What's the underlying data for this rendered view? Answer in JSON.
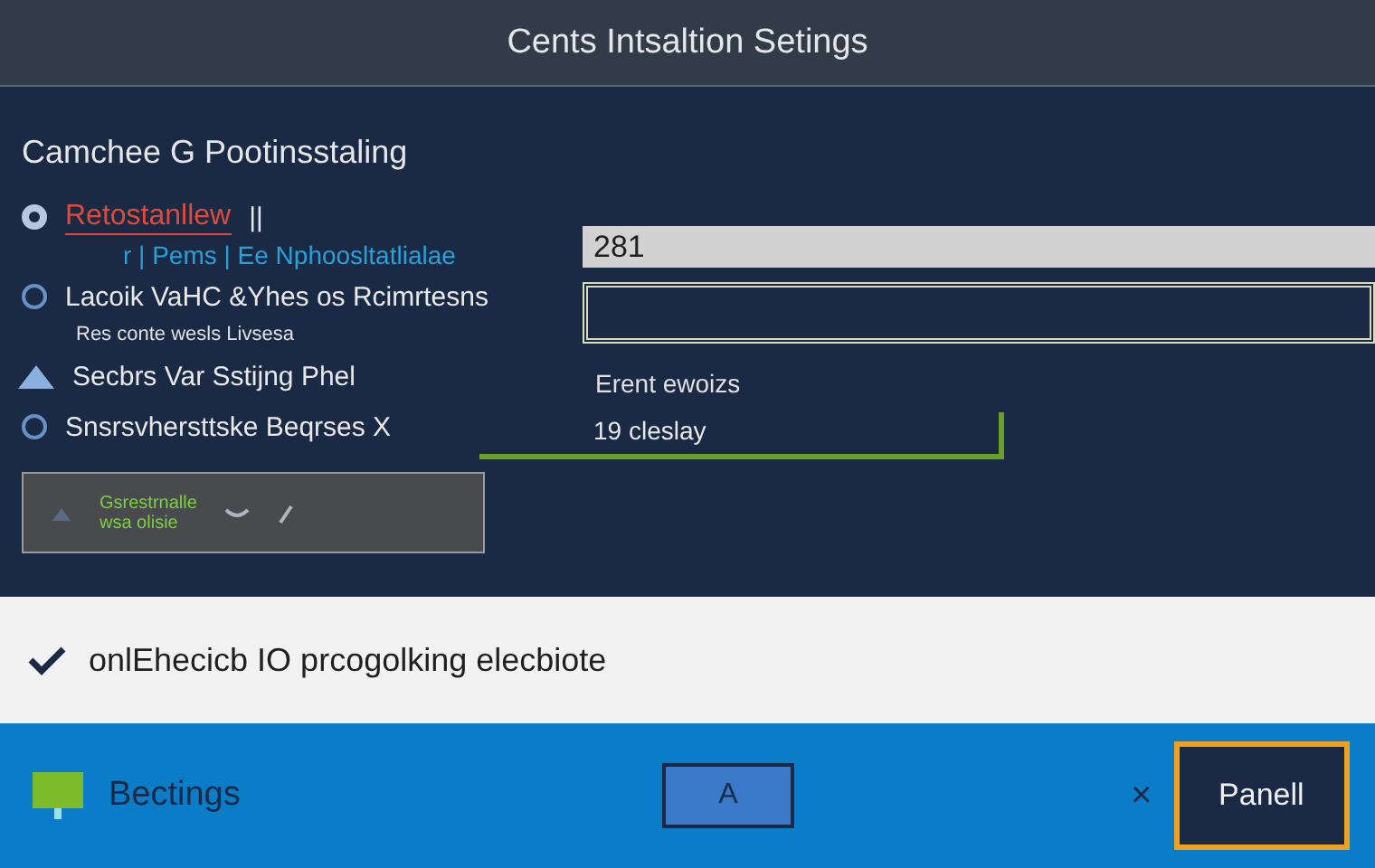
{
  "window": {
    "title": "Cents Intsaltion Setings"
  },
  "heading": "Camchee G Pootinsstaling",
  "options": [
    {
      "kind": "radio",
      "selected": true,
      "label": "Retostanllew",
      "suffix": "||",
      "caption": "r | Pems | Ee Nphoosltatlialae"
    },
    {
      "kind": "radio",
      "selected": false,
      "label": "Lacoik VaHC &Yhes os Rcimrtesns",
      "caption": "Res conte wesls Livsesa"
    },
    {
      "kind": "triangle",
      "label": "Secbrs Var  Sstijng Phel"
    },
    {
      "kind": "radio",
      "selected": false,
      "label": "Snsrsvhersttske Beqrses X"
    }
  ],
  "preview": {
    "lines": [
      "Gsrestrnalle",
      "wsa olisie"
    ]
  },
  "fields": [
    {
      "kind": "filled",
      "value": "281"
    },
    {
      "kind": "outlined"
    }
  ],
  "details": [
    {
      "kind": "plain",
      "text": "Erent ewoizs"
    },
    {
      "kind": "readout",
      "text": "19 cleslay"
    }
  ],
  "notice": {
    "checked": true,
    "text": "onlEhecicb IO prcogolking elecbiote"
  },
  "footer": {
    "label": "Bectings",
    "buttons": [
      {
        "kind": "outlined",
        "label": "A"
      },
      {
        "kind": "close",
        "label": "×"
      },
      {
        "kind": "primary",
        "label": "Panell"
      }
    ]
  }
}
